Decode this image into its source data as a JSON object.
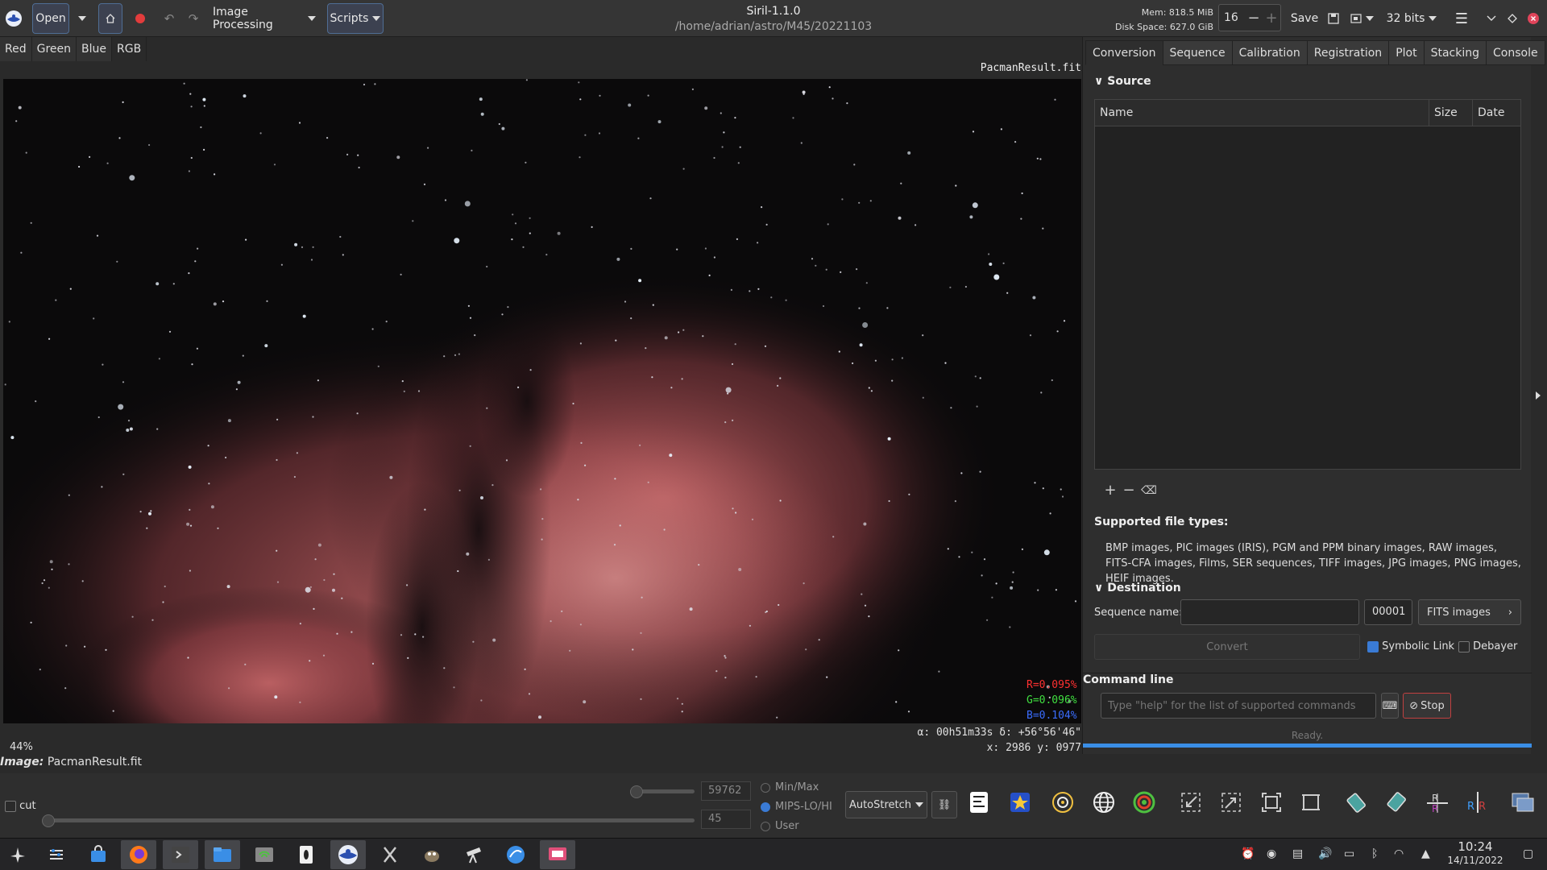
{
  "header": {
    "open_label": "Open",
    "image_processing_label": "Image Processing",
    "scripts_label": "Scripts",
    "app_title": "Siril-1.1.0",
    "app_path": "/home/adrian/astro/M45/20221103",
    "mem": "Mem: 818.5 MiB",
    "disk": "Disk Space: 627.0 GiB",
    "threads_value": "16",
    "save_label": "Save",
    "bitdepth_label": "32 bits"
  },
  "image_tabs": [
    "Red",
    "Green",
    "Blue",
    "RGB"
  ],
  "image": {
    "filename": "PacmanResult.fit",
    "zoom": "44%",
    "r_value": "R=0.095%",
    "g_value": "G=0.096%",
    "b_value": "B=0.104%",
    "coords": "α: 00h51m33s  δ: +56°56'46\"",
    "xy": "x: 2986  y: 0977",
    "label_prefix": "Image:",
    "label_name": "PacmanResult.fit"
  },
  "right_tabs": [
    "Conversion",
    "Sequence",
    "Calibration",
    "Registration",
    "Plot",
    "Stacking",
    "Console"
  ],
  "conversion": {
    "source_heading": "Source",
    "col_name": "Name",
    "col_size": "Size",
    "col_date": "Date",
    "supported_heading": "Supported file types:",
    "supported_text": "BMP images, PIC images (IRIS), PGM and PPM binary images, RAW images, FITS-CFA images, Films, SER sequences, TIFF images, JPG images, PNG images, HEIF images.",
    "destination_heading": "Destination",
    "sequence_name_label": "Sequence name:",
    "sequence_name_value": "",
    "start_index": "00001",
    "output_type": "FITS images",
    "convert_label": "Convert",
    "symbolic_link_label": "Symbolic Link",
    "symbolic_link_checked": true,
    "debayer_label": "Debayer",
    "debayer_checked": false
  },
  "command_line": {
    "heading": "Command line",
    "placeholder": "Type \"help\" for the list of supported commands",
    "stop_label": "Stop",
    "status": "Ready."
  },
  "bottom": {
    "cut_label": "cut",
    "high_value": "59762",
    "low_value": "45",
    "minmax_label": "Min/Max",
    "mips_label": "MIPS-LO/HI",
    "user_label": "User",
    "mode_label": "AutoStretch"
  },
  "taskbar": {
    "time": "10:24",
    "date": "14/11/2022"
  },
  "colors": {
    "accent": "#3a7bd5",
    "stop_border": "#c04040",
    "nebula": "#c0585a",
    "r_text": "#ff3030",
    "g_text": "#40e040",
    "b_text": "#3a6dff"
  }
}
